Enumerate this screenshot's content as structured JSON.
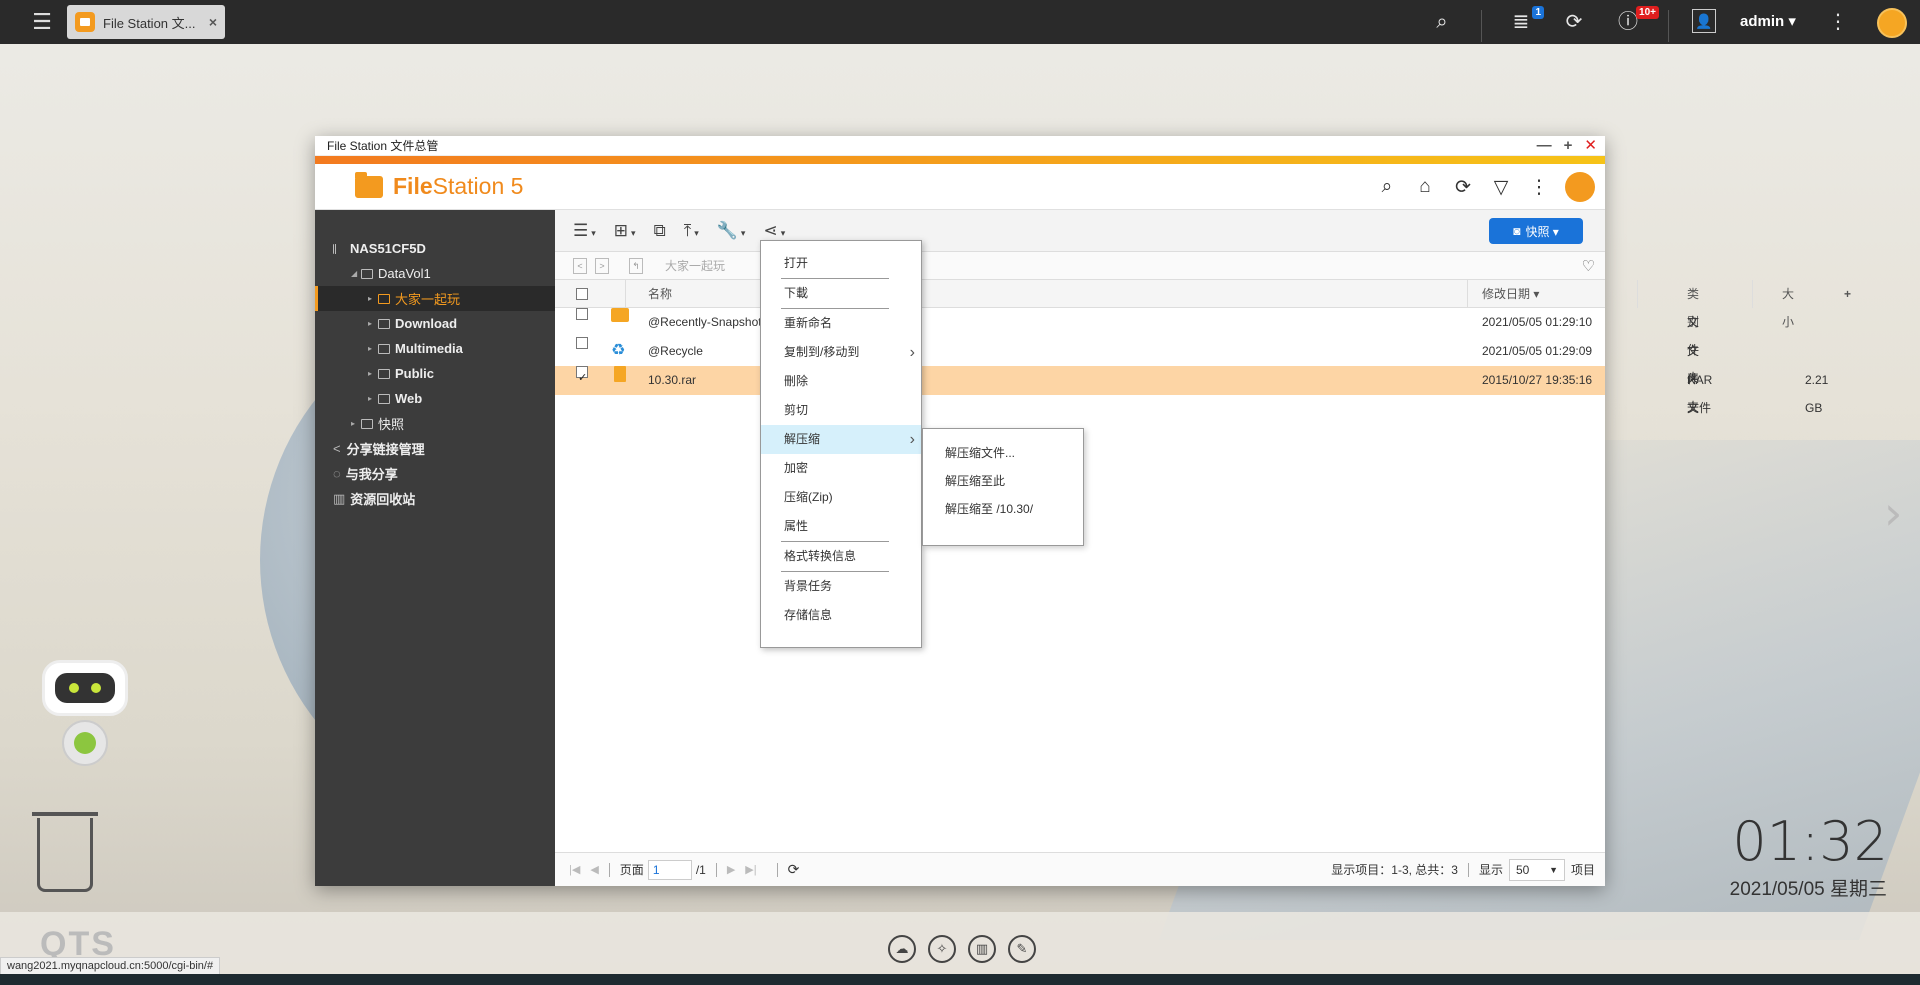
{
  "taskbar": {
    "tab_label": "File Station 文...",
    "close_glyph": "×",
    "notif_badge": "1",
    "info_badge": "10+",
    "user": "admin ▾"
  },
  "window": {
    "title": "File Station 文件总管",
    "app_name_bold": "File",
    "app_name_rest": "Station 5",
    "snapshot_label": "快照 ▾"
  },
  "sidebar": {
    "nas": "NAS51CF5D",
    "volume": "DataVol1",
    "folders": [
      "大家一起玩",
      "Download",
      "Multimedia",
      "Public",
      "Web"
    ],
    "snapshot": "快照",
    "share_links": "分享链接管理",
    "shared_with_me": "与我分享",
    "recycle": "资源回收站"
  },
  "pathbar": {
    "path": "大家一起玩"
  },
  "table": {
    "headers": {
      "name": "名称",
      "modified": "修改日期 ▾",
      "type": "类别",
      "size": "大小"
    },
    "rows": [
      {
        "name": "@Recently-Snapshot",
        "modified": "2021/05/05 01:29:10",
        "type": "文件夹",
        "size": ""
      },
      {
        "name": "@Recycle",
        "modified": "2021/05/05 01:29:09",
        "type": "文件夹",
        "size": ""
      },
      {
        "name": "10.30.rar",
        "modified": "2015/10/27 19:35:16",
        "type": "RAR 文件",
        "size": "2.21 GB"
      }
    ]
  },
  "footer": {
    "page_label": "页面",
    "page_value": "1",
    "page_total": "/1",
    "items_info": "显示项目：1-3, 总共：3",
    "show_label": "显示",
    "show_value": "50",
    "items_label": "项目"
  },
  "context_menu": {
    "items": [
      "打开",
      "下載",
      "重新命名",
      "复制到/移动到",
      "刪除",
      "剪切",
      "解压缩",
      "加密",
      "压缩(Zip)",
      "属性",
      "格式转换信息",
      "背景任务",
      "存储信息"
    ],
    "submenu": [
      "解压缩文件...",
      "解压缩至此",
      "解压缩至 /10.30/"
    ]
  },
  "desktop": {
    "time": "01:32",
    "date": "2021/05/05 星期三",
    "qts": "QTS",
    "status_url": "wang2021.myqnapcloud.cn:5000/cgi-bin/#"
  },
  "colors": {
    "accent": "#f39a1f",
    "selection": "#fdd5a5",
    "menu_highlight": "#d6f0fb",
    "snapshot_button": "#1a73d9"
  }
}
